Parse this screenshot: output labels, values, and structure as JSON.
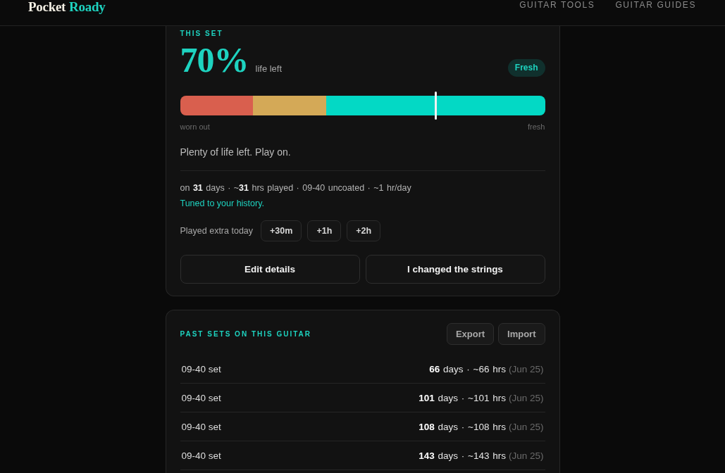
{
  "header": {
    "brand": {
      "name": "Pocket",
      "accent": "Roady"
    },
    "nav": [
      {
        "label": "GUITAR TOOLS"
      },
      {
        "label": "GUITAR GUIDES"
      }
    ]
  },
  "this_set": {
    "label": "THIS SET",
    "percent": "70%",
    "percent_caption": "life left",
    "badge": "Fresh",
    "gauge": {
      "level": 0.7,
      "low_label": "worn out",
      "high_label": "fresh"
    },
    "message": "Plenty of life left. Play on.",
    "stats": "on **31** days · ~**31** hrs played · 09-40 uncoated · ~1 hr/day",
    "note": "Tuned to your history.",
    "extra": {
      "label": "Played extra today",
      "options": [
        "+30m",
        "+1h",
        "+2h"
      ]
    },
    "actions": [
      "Edit details",
      "I changed the strings"
    ]
  },
  "past_sets": {
    "title": "PAST SETS ON THIS GUITAR",
    "actions": [
      "Export",
      "Import"
    ],
    "rows": [
      {
        "name": "09-40 set",
        "summary": "**66** days · ~66 hrs",
        "date": "(Jun 25)"
      },
      {
        "name": "09-40 set",
        "summary": "**101** days · ~101 hrs",
        "date": "(Jun 25)"
      },
      {
        "name": "09-40 set",
        "summary": "**108** days · ~108 hrs",
        "date": "(Jun 25)"
      },
      {
        "name": "09-40 set",
        "summary": "**143** days · ~143 hrs",
        "date": "(Jun 25)"
      }
    ]
  }
}
